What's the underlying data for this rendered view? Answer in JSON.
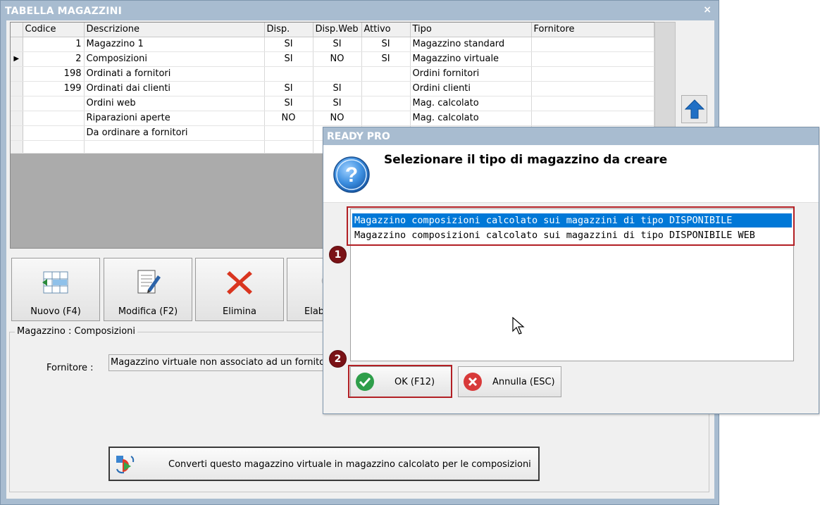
{
  "main_window": {
    "title": "TABELLA MAGAZZINI",
    "close_glyph": "×"
  },
  "grid": {
    "columns": [
      "Codice",
      "Descrizione",
      "Disp.",
      "Disp.Web",
      "Attivo",
      "Tipo",
      "Fornitore"
    ],
    "rows": [
      {
        "codice": "1",
        "descrizione": "Magazzino 1",
        "disp": "SI",
        "disp_web": "SI",
        "attivo": "SI",
        "tipo": "Magazzino standard",
        "fornitore": "",
        "current": false
      },
      {
        "codice": "2",
        "descrizione": "Composizioni",
        "disp": "SI",
        "disp_web": "NO",
        "attivo": "SI",
        "tipo": "Magazzino virtuale",
        "fornitore": "",
        "current": true
      },
      {
        "codice": "198",
        "descrizione": "Ordinati a fornitori",
        "disp": "",
        "disp_web": "",
        "attivo": "",
        "tipo": "Ordini fornitori",
        "fornitore": "",
        "current": false
      },
      {
        "codice": "199",
        "descrizione": "Ordinati dai clienti",
        "disp": "SI",
        "disp_web": "SI",
        "attivo": "",
        "tipo": "Ordini clienti",
        "fornitore": "",
        "current": false
      },
      {
        "codice": "",
        "descrizione": "Ordini web",
        "disp": "SI",
        "disp_web": "SI",
        "attivo": "",
        "tipo": "Mag. calcolato",
        "fornitore": "",
        "current": false
      },
      {
        "codice": "",
        "descrizione": "Riparazioni aperte",
        "disp": "NO",
        "disp_web": "NO",
        "attivo": "",
        "tipo": "Mag. calcolato",
        "fornitore": "",
        "current": false
      },
      {
        "codice": "",
        "descrizione": "Da ordinare a fornitori",
        "disp": "",
        "disp_web": "",
        "attivo": "",
        "tipo": "",
        "fornitore": "",
        "current": false
      }
    ],
    "current_row_marker": "▶"
  },
  "toolbar": {
    "new_label": "Nuovo (F4)",
    "edit_label": "Modifica (F2)",
    "delete_label": "Elimina",
    "process_label": "Elab"
  },
  "details": {
    "group_title": "Magazzino : Composizioni",
    "supplier_label": "Fornitore :",
    "supplier_value": "Magazzino virtuale non associato ad un fornitore",
    "convert_label": "Converti questo magazzino virtuale in magazzino calcolato per le composizioni"
  },
  "dialog": {
    "title": "READY PRO",
    "heading": "Selezionare il tipo di magazzino da creare",
    "options": [
      "Magazzino composizioni calcolato sui magazzini di tipo DISPONIBILE",
      "Magazzino composizioni calcolato sui magazzini di tipo DISPONIBILE WEB"
    ],
    "selected_index": 0,
    "ok_label": "OK (F12)",
    "cancel_label": "Annulla (ESC)"
  },
  "callouts": {
    "step1": "1",
    "step2": "2"
  },
  "colors": {
    "title_bar": "#a8bcd0",
    "selection": "#0078d7",
    "callout_border": "#b21f24",
    "callout_badge": "#7a1216"
  }
}
